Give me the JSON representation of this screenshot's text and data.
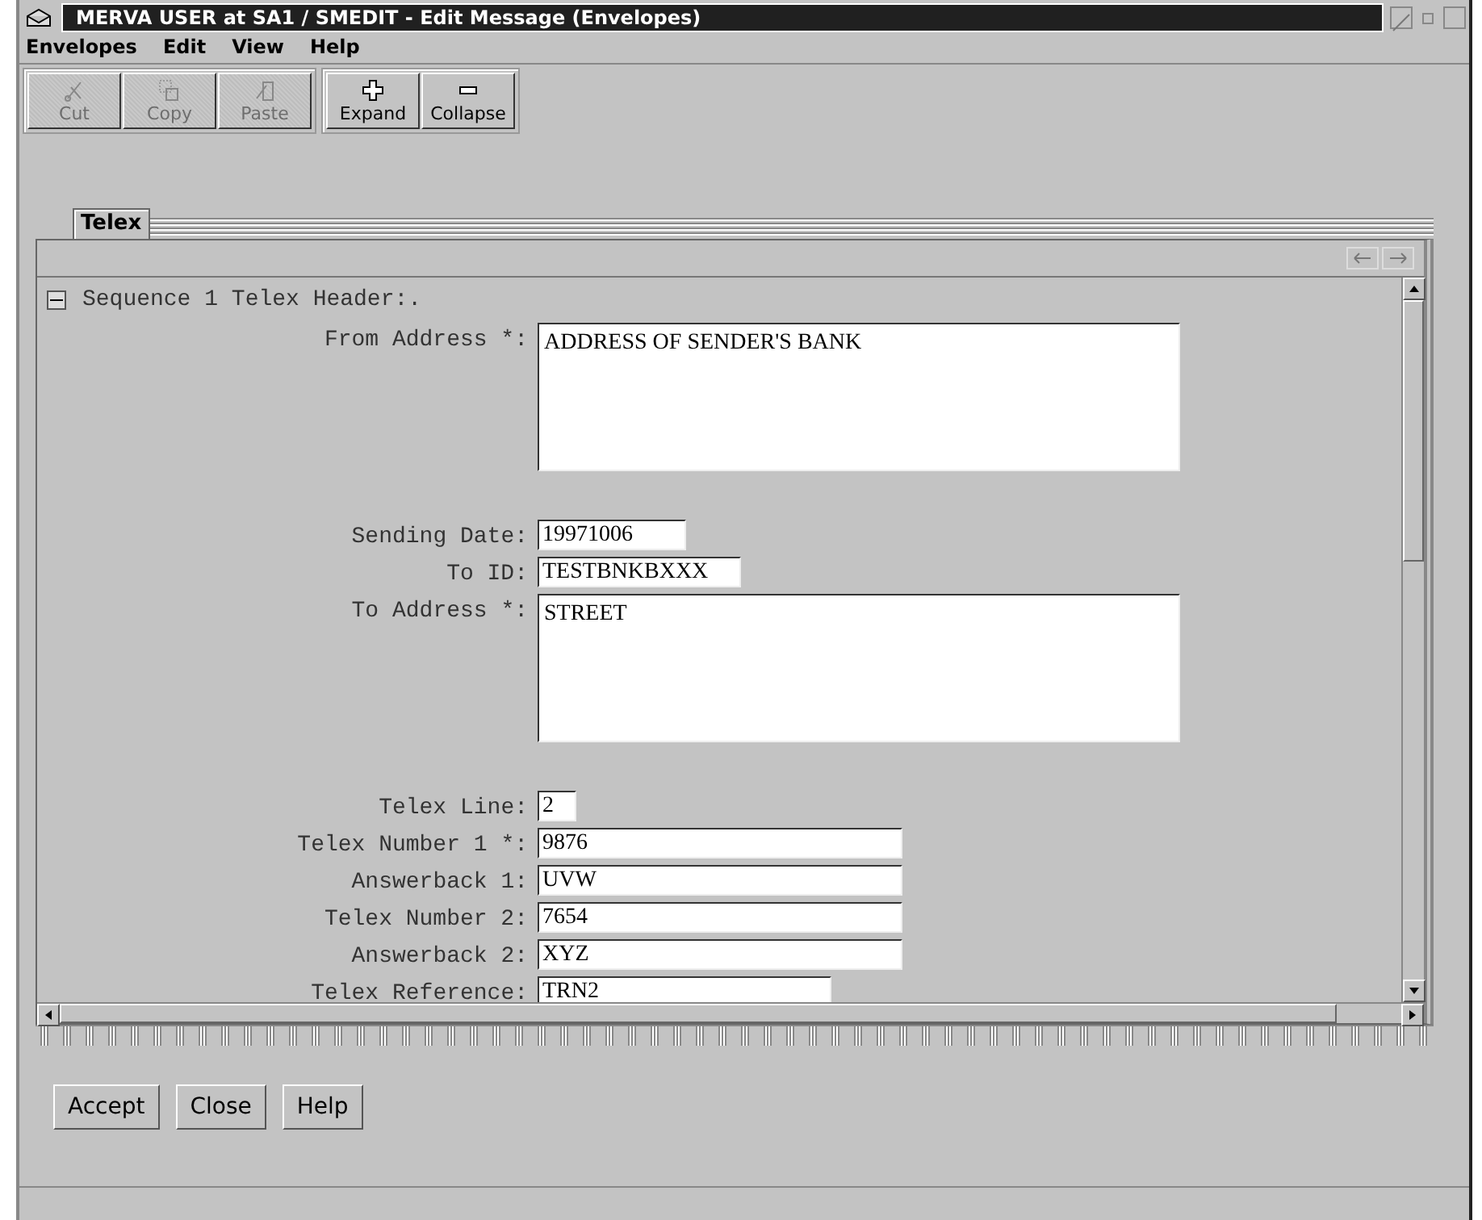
{
  "window": {
    "title": "MERVA USER at SA1 / SMEDIT - Edit Message (Envelopes)"
  },
  "menu": [
    "Envelopes",
    "Edit",
    "View",
    "Help"
  ],
  "toolbar": [
    {
      "label": "Cut",
      "disabled": true
    },
    {
      "label": "Copy",
      "disabled": true
    },
    {
      "label": "Paste",
      "disabled": true
    },
    {
      "label": "Expand",
      "disabled": false
    },
    {
      "label": "Collapse",
      "disabled": false
    }
  ],
  "tabs": [
    {
      "label": "Telex",
      "selected": true
    }
  ],
  "sequence": {
    "title": "Sequence 1 Telex Header:.",
    "expanded": true
  },
  "fields": [
    {
      "label": "From Address *:",
      "value": "ADDRESS OF SENDER'S BANK",
      "kind": "area"
    },
    {
      "label": "Sending Date:",
      "value": "19971006",
      "kind": "date"
    },
    {
      "label": "To ID:",
      "value": "TESTBNKBXXX",
      "kind": "id"
    },
    {
      "label": "To Address *:",
      "value": "STREET",
      "kind": "area"
    },
    {
      "label": "Telex Line:",
      "value": "2",
      "kind": "tiny"
    },
    {
      "label": "Telex Number 1 *:",
      "value": "9876",
      "kind": "line"
    },
    {
      "label": "Answerback 1:",
      "value": "UVW",
      "kind": "line"
    },
    {
      "label": "Telex Number 2:",
      "value": "7654",
      "kind": "line"
    },
    {
      "label": "Answerback 2:",
      "value": "XYZ",
      "kind": "line"
    },
    {
      "label": "Telex Reference:",
      "value": "TRN2",
      "kind": "ref"
    }
  ],
  "buttons": [
    "Accept",
    "Close",
    "Help"
  ]
}
